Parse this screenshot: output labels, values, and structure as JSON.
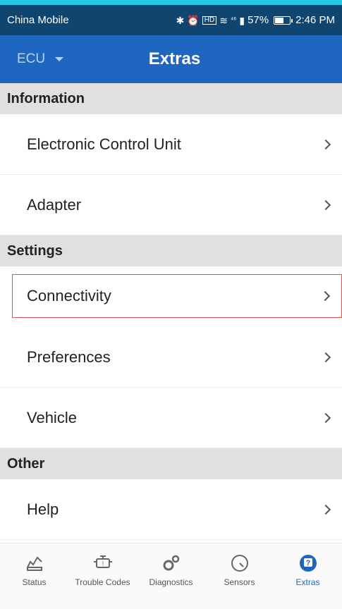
{
  "status_bar": {
    "carrier": "China Mobile",
    "network": "⁴⁶",
    "battery": "57%",
    "time": "2:46 PM",
    "hd_badge": "HD"
  },
  "app_bar": {
    "dropdown_label": "ECU",
    "title": "Extras"
  },
  "sections": [
    {
      "title": "Information",
      "items": [
        "Electronic Control Unit",
        "Adapter"
      ]
    },
    {
      "title": "Settings",
      "items": [
        "Connectivity",
        "Preferences",
        "Vehicle"
      ]
    },
    {
      "title": "Other",
      "items": [
        "Help"
      ]
    }
  ],
  "bottom_nav": {
    "items": [
      "Status",
      "Trouble Codes",
      "Diagnostics",
      "Sensors",
      "Extras"
    ],
    "active": "Extras"
  },
  "colors": {
    "app_bar": "#1f66c1",
    "status_bar": "#10456f",
    "accent_strip": "#25c8e6",
    "highlight_border": "#d9534f",
    "section_bg": "#e0e0e0"
  }
}
